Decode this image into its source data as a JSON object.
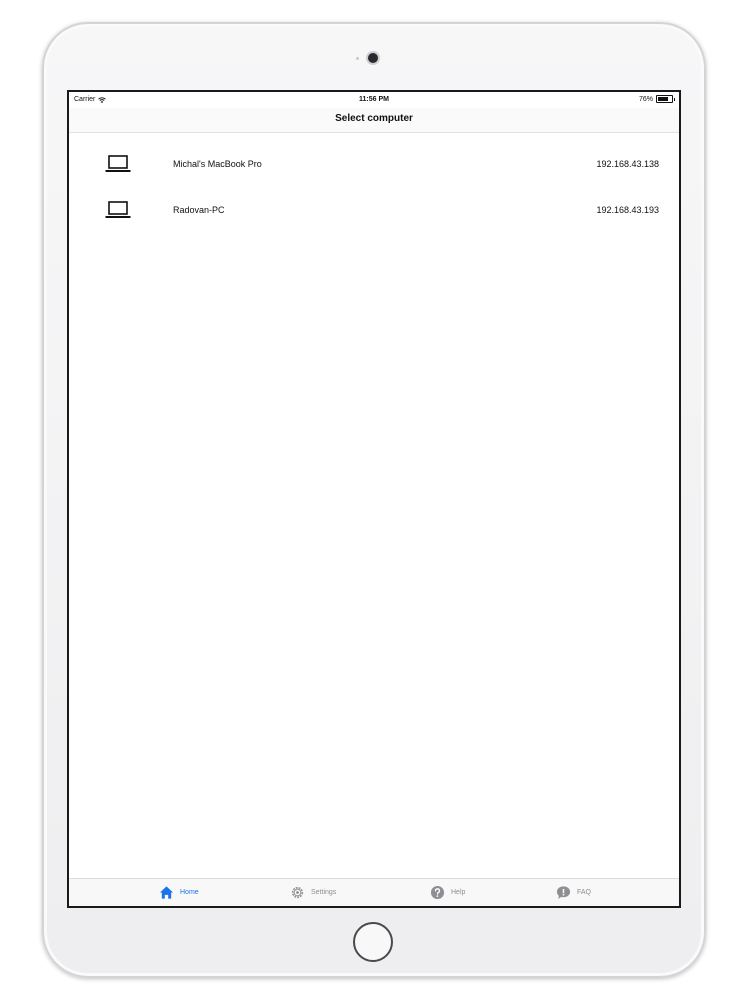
{
  "status_bar": {
    "carrier": "Carrier",
    "time": "11:56 PM",
    "battery": "76%",
    "battery_level": 0.76
  },
  "nav": {
    "title": "Select computer"
  },
  "computers": [
    {
      "name": "Michal's MacBook Pro",
      "ip": "192.168.43.138",
      "icon": "laptop-icon"
    },
    {
      "name": "Radovan-PC",
      "ip": "192.168.43.193",
      "icon": "laptop-icon"
    }
  ],
  "tabs": [
    {
      "label": "Home",
      "icon": "home-icon",
      "active": true
    },
    {
      "label": "Settings",
      "icon": "gear-icon",
      "active": false
    },
    {
      "label": "Help",
      "icon": "question-icon",
      "active": false
    },
    {
      "label": "FAQ",
      "icon": "chat-bubble-icon",
      "active": false
    }
  ],
  "colors": {
    "accent": "#1a73e8",
    "inactive": "#8e8e93"
  }
}
